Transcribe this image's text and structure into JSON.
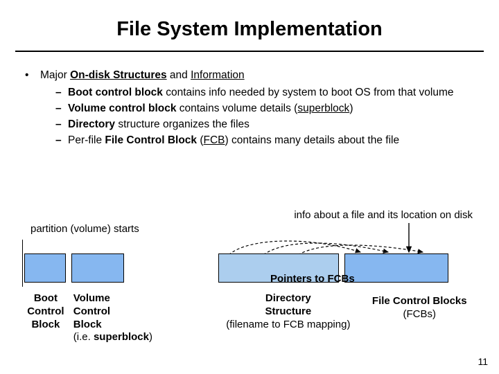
{
  "title": "File System Implementation",
  "bullet_intro_pre": "Major ",
  "bullet_intro_u1": "On-disk Structures",
  "bullet_intro_mid": " and ",
  "bullet_intro_u2": "Information",
  "sub1_b": "Boot control block",
  "sub1_r": " contains info needed by system to boot OS from that volume",
  "sub2_b": "Volume control block",
  "sub2_r1": " contains volume details (",
  "sub2_u": "superblock",
  "sub2_r2": ")",
  "sub3_b": "Directory",
  "sub3_r": " structure organizes the files",
  "sub4_r1": "Per-file ",
  "sub4_b": "File Control Block",
  "sub4_r2": " (",
  "sub4_u": "FCB",
  "sub4_r3": ") contains many details about the file",
  "ann_left": "partition (volume) starts",
  "ann_right": "info about a file and its location on disk",
  "ptr_label": "Pointers to FCBs",
  "lab_boot_l1": "Boot",
  "lab_boot_l2": "Control",
  "lab_boot_l3": "Block",
  "lab_vol_l1": "Volume",
  "lab_vol_l2": "Control",
  "lab_vol_l3": "Block",
  "lab_vol_sub_pre": "(i.e. ",
  "lab_vol_sub_b": "superblock",
  "lab_vol_sub_post": ")",
  "lab_dir_l1": "Directory",
  "lab_dir_l2": "Structure",
  "lab_dir_l3": "(filename to FCB mapping)",
  "lab_fcbs_l1": "File Control Blocks",
  "lab_fcbs_l2": "(FCBs)",
  "page_num": "11"
}
